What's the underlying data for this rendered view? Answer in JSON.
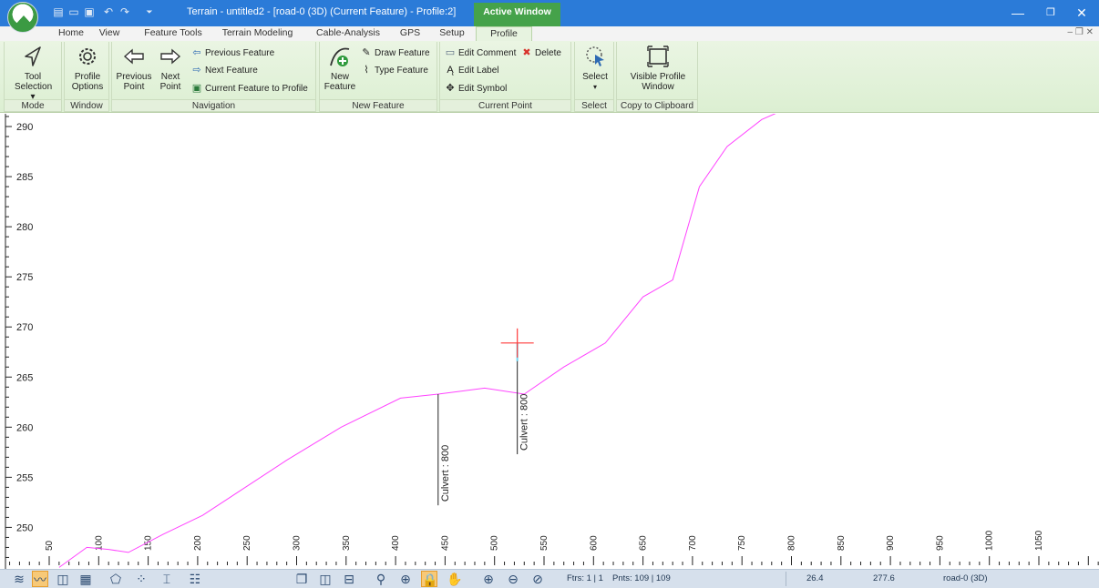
{
  "window": {
    "title": "Terrain - untitled2 - [road-0 (3D) (Current Feature) - Profile:2]",
    "active_window_label": "Active Window"
  },
  "tabs": [
    "Home",
    "View",
    "Feature Tools",
    "Terrain Modeling",
    "Cable-Analysis",
    "GPS",
    "Setup",
    "Profile"
  ],
  "active_tab": "Profile",
  "ribbon": {
    "mode": {
      "label": "Mode",
      "tool_selection": "Tool Selection ▾"
    },
    "window": {
      "label": "Window",
      "profile_options": "Profile Options"
    },
    "navigation": {
      "label": "Navigation",
      "previous_point": "Previous Point",
      "next_point": "Next Point",
      "previous_feature": "Previous Feature",
      "next_feature": "Next Feature",
      "current_feature_to_profile": "Current Feature to Profile"
    },
    "new_feature": {
      "label": "New Feature",
      "new_feature": "New Feature",
      "draw_feature": "Draw Feature",
      "type_feature": "Type Feature"
    },
    "current_point": {
      "label": "Current Point",
      "edit_comment": "Edit Comment",
      "delete": "Delete",
      "edit_label": "Edit Label",
      "edit_symbol": "Edit Symbol"
    },
    "select": {
      "label": "Select",
      "select": "Select"
    },
    "clipboard": {
      "label": "Copy to Clipboard",
      "visible_profile_window": "Visible Profile Window"
    }
  },
  "colors": {
    "profile_line": "#ff44ff",
    "crosshair": "#ff3b3b",
    "titlebar": "#2b7bd8",
    "active_tab_bg": "#45a24a"
  },
  "chart_data": {
    "type": "line",
    "xlim": [
      0,
      1080
    ],
    "ylim": [
      247,
      291
    ],
    "y_ticks": [
      250,
      255,
      260,
      265,
      270,
      275,
      280,
      285,
      290
    ],
    "x_ticks": [
      50,
      100,
      150,
      200,
      250,
      300,
      350,
      400,
      450,
      500,
      550,
      600,
      650,
      700,
      750,
      800,
      850,
      900,
      950,
      1000,
      1050
    ],
    "series": [
      {
        "x": [
          60,
          88,
          110,
          130,
          165,
          205,
          290,
          345,
          405,
          443,
          490,
          530,
          570,
          612,
          650,
          680,
          707,
          735,
          770,
          800
        ],
        "y": [
          246,
          248,
          247.8,
          247.5,
          249.3,
          251.2,
          256.7,
          260,
          262.9,
          263.3,
          263.9,
          263.3,
          266,
          268.4,
          273,
          274.7,
          284,
          288,
          290.7,
          292
        ]
      }
    ],
    "markers": [
      {
        "x": 443,
        "y": 263.3,
        "label": "Culvert : 800",
        "stem_to_y": 252.2
      },
      {
        "x": 523,
        "y": 268.4,
        "label": "Culvert : 800",
        "stem_to_y": 257.3,
        "current": true
      }
    ]
  },
  "status": {
    "features": "Ftrs: 1 | 1",
    "points": "Pnts: 109 | 109",
    "coord_x": "26.4",
    "coord_y": "277.6",
    "feature_name": "road-0 (3D)"
  }
}
